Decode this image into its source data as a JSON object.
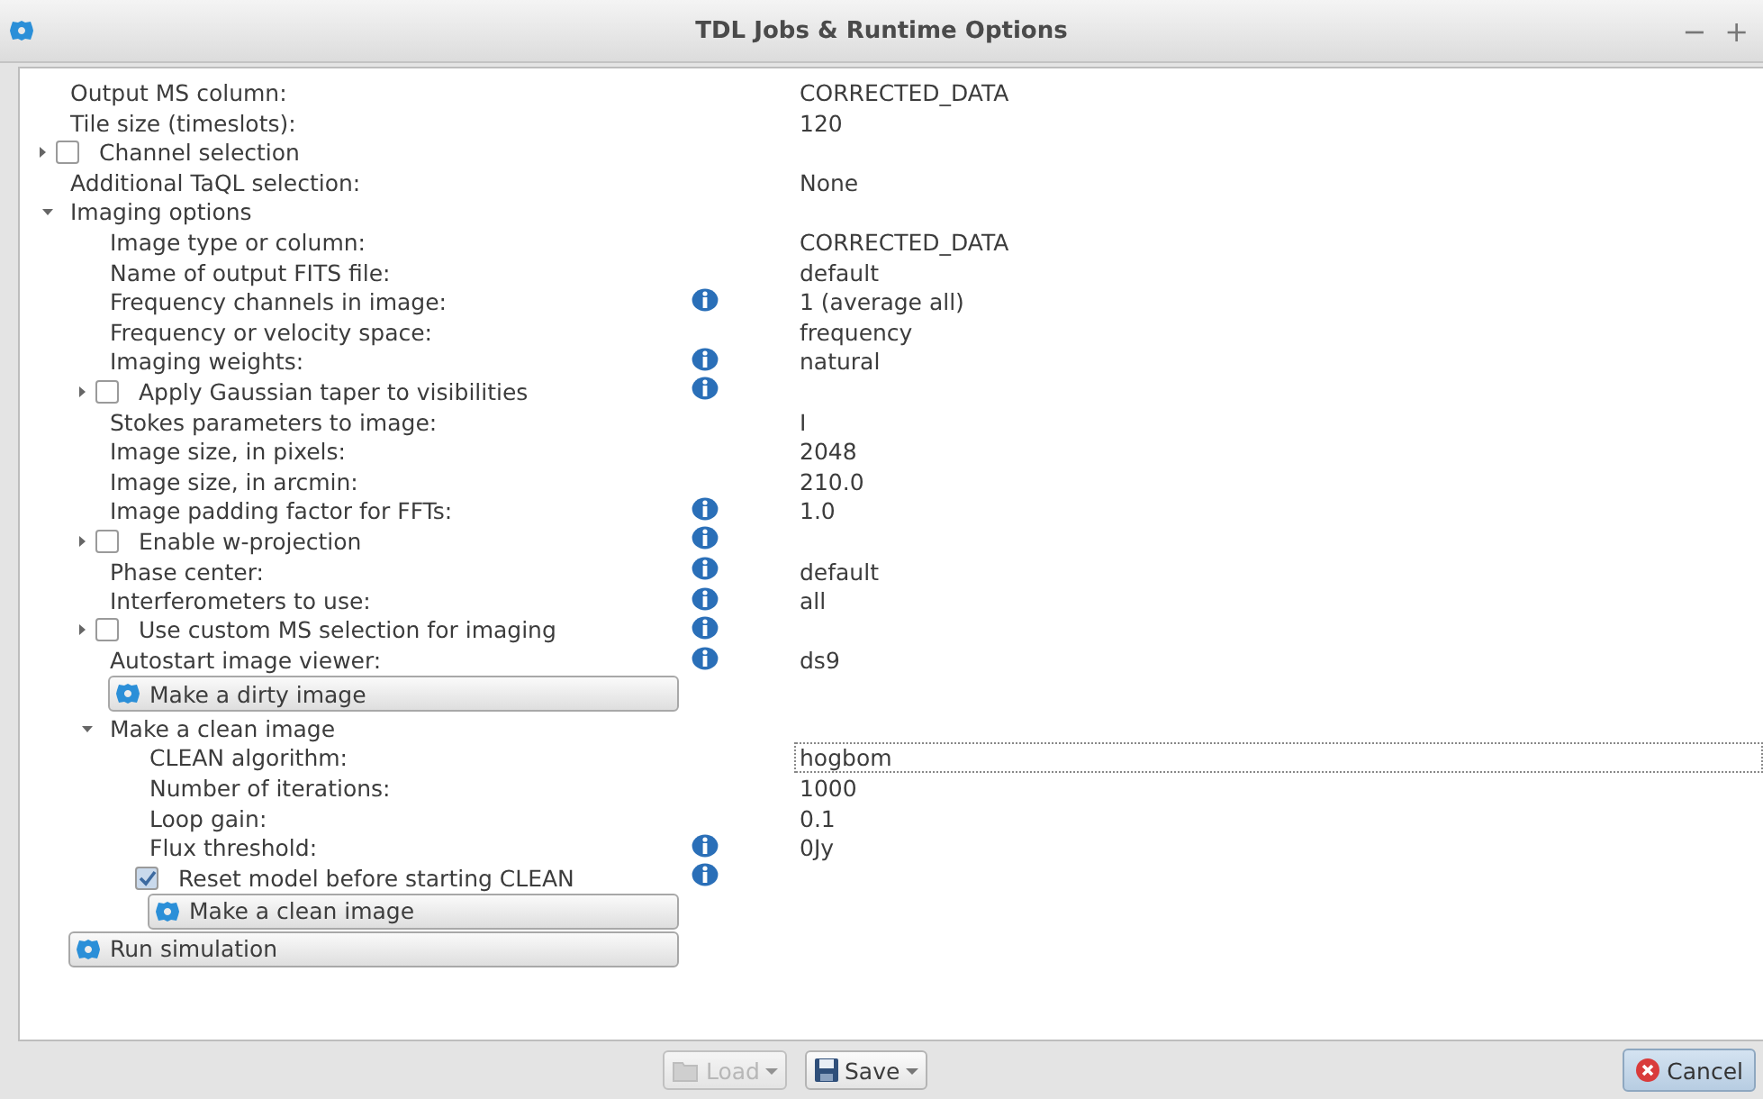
{
  "window": {
    "title": "TDL Jobs & Runtime Options",
    "controls": [
      "−",
      "+"
    ]
  },
  "options": [
    {
      "kind": "field",
      "label": "Output MS column:",
      "value": "CORRECTED_DATA",
      "info": false
    },
    {
      "kind": "field",
      "label": "Tile size (timeslots):",
      "value": "120",
      "info": false
    },
    {
      "kind": "checkbox",
      "label": "Channel selection",
      "checked": false,
      "expanded": false,
      "info": false
    },
    {
      "kind": "field",
      "label": "Additional TaQL selection:",
      "value": "None",
      "info": false
    },
    {
      "kind": "group",
      "label": "Imaging options",
      "expanded": true,
      "children": [
        {
          "kind": "field",
          "label": "Image type or column:",
          "value": "CORRECTED_DATA",
          "info": false
        },
        {
          "kind": "field",
          "label": "Name of output FITS file:",
          "value": "default",
          "info": false
        },
        {
          "kind": "field",
          "label": "Frequency channels in image:",
          "value": "1 (average all)",
          "info": true
        },
        {
          "kind": "field",
          "label": "Frequency or velocity space:",
          "value": "frequency",
          "info": false
        },
        {
          "kind": "field",
          "label": "Imaging weights:",
          "value": "natural",
          "info": true
        },
        {
          "kind": "checkbox",
          "label": "Apply Gaussian taper to visibilities",
          "checked": false,
          "expanded": false,
          "info": true
        },
        {
          "kind": "field",
          "label": "Stokes parameters to image:",
          "value": "I",
          "info": false
        },
        {
          "kind": "field",
          "label": "Image size, in pixels:",
          "value": "2048",
          "info": false
        },
        {
          "kind": "field",
          "label": "Image size, in arcmin:",
          "value": "210.0",
          "info": false
        },
        {
          "kind": "field",
          "label": "Image padding factor for FFTs:",
          "value": "1.0",
          "info": true
        },
        {
          "kind": "checkbox",
          "label": "Enable w-projection",
          "checked": false,
          "expanded": false,
          "info": true
        },
        {
          "kind": "field",
          "label": "Phase center:",
          "value": "default",
          "info": true
        },
        {
          "kind": "field",
          "label": "Interferometers to use:",
          "value": "all",
          "info": true
        },
        {
          "kind": "checkbox",
          "label": "Use custom MS selection for imaging",
          "checked": false,
          "expanded": false,
          "info": true
        },
        {
          "kind": "field",
          "label": "Autostart image viewer:",
          "value": "ds9",
          "info": true
        },
        {
          "kind": "button",
          "label": "Make a dirty image"
        },
        {
          "kind": "group",
          "label": "Make a clean image",
          "expanded": true,
          "children": [
            {
              "kind": "field",
              "label": "CLEAN algorithm:",
              "value": "hogbom",
              "info": false,
              "focused": true
            },
            {
              "kind": "field",
              "label": "Number of iterations:",
              "value": "1000",
              "info": false
            },
            {
              "kind": "field",
              "label": "Loop gain:",
              "value": "0.1",
              "info": false
            },
            {
              "kind": "field",
              "label": "Flux threshold:",
              "value": "0Jy",
              "info": true
            },
            {
              "kind": "checkbox",
              "label": "Reset model before starting CLEAN",
              "checked": true,
              "info": true
            },
            {
              "kind": "button",
              "label": "Make a clean image"
            }
          ]
        }
      ]
    },
    {
      "kind": "button",
      "label": "Run simulation"
    }
  ],
  "footer": {
    "buttons": [
      {
        "kind": "folder",
        "label": "Load",
        "disabled": true,
        "dropdown": true
      },
      {
        "kind": "floppy",
        "label": "Save",
        "disabled": false,
        "dropdown": true
      }
    ],
    "cancel": {
      "label": "Cancel"
    }
  }
}
